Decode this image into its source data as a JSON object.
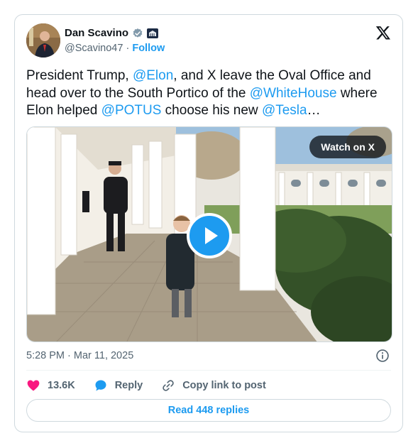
{
  "author": {
    "name": "Dan Scavino",
    "handle": "@Scavino47",
    "separator": "·",
    "follow_label": "Follow"
  },
  "tweet": {
    "segments": [
      {
        "text": "President Trump, ",
        "mention": false
      },
      {
        "text": "@Elon",
        "mention": true
      },
      {
        "text": ", and X leave the Oval Office and head over to the South Portico of the ",
        "mention": false
      },
      {
        "text": "@WhiteHouse",
        "mention": true
      },
      {
        "text": " where Elon helped ",
        "mention": false
      },
      {
        "text": "@POTUS",
        "mention": true
      },
      {
        "text": " choose his new ",
        "mention": false
      },
      {
        "text": "@Tesla",
        "mention": true
      },
      {
        "text": "…",
        "mention": false
      }
    ]
  },
  "media": {
    "watch_label": "Watch on X"
  },
  "meta": {
    "timestamp": "5:28 PM · Mar 11, 2025"
  },
  "actions": {
    "likes": "13.6K",
    "reply_label": "Reply",
    "copy_label": "Copy link to post"
  },
  "footer": {
    "read_replies": "Read 448 replies"
  },
  "colors": {
    "accent": "#1d9bf0",
    "like": "#f91880",
    "text": "#0f1419",
    "muted": "#536471"
  },
  "icons": [
    "verified-badge-icon",
    "white-house-badge-icon",
    "x-logo-icon",
    "play-icon",
    "info-icon",
    "heart-icon",
    "reply-bubble-icon",
    "link-icon"
  ]
}
